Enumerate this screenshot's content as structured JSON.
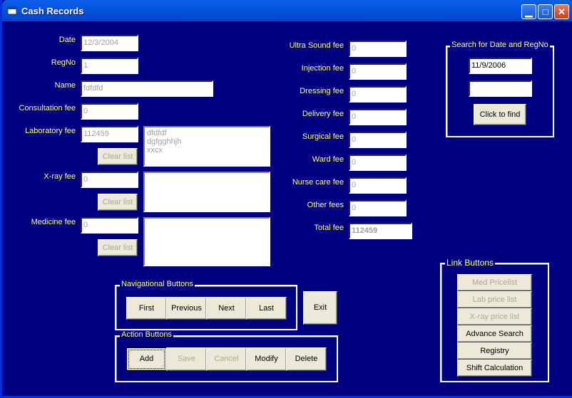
{
  "window": {
    "title": "Cash Records"
  },
  "left_fields": {
    "date": {
      "label": "Date",
      "value": "12/3/2004"
    },
    "regno": {
      "label": "RegNo",
      "value": "1"
    },
    "name": {
      "label": "Name",
      "value": "fdfdfd"
    },
    "consultation": {
      "label": "Consultation fee",
      "value": "0"
    },
    "laboratory": {
      "label": "Laboratory fee",
      "value": "112459",
      "list": [
        "dfdfdf",
        "dgfgghhjh",
        "xxcx"
      ],
      "clear_label": "Clear list"
    },
    "xray": {
      "label": "X-ray fee",
      "value": "0",
      "clear_label": "Clear list"
    },
    "medicine": {
      "label": "Medicine fee",
      "value": "0",
      "clear_label": "Clear list"
    }
  },
  "mid_fields": [
    {
      "label": "Ultra Sound fee",
      "value": "0"
    },
    {
      "label": "Injection fee",
      "value": "0"
    },
    {
      "label": "Dressing fee",
      "value": "0"
    },
    {
      "label": "Delivery fee",
      "value": "0"
    },
    {
      "label": "Surgical fee",
      "value": "0"
    },
    {
      "label": "Ward fee",
      "value": "0"
    },
    {
      "label": "Nurse care fee",
      "value": "0"
    },
    {
      "label": "Other fees",
      "value": "0"
    }
  ],
  "total": {
    "label": "Total fee",
    "value": "112459"
  },
  "search": {
    "title": "Search for Date and RegNo",
    "date_value": "11/9/2006",
    "regno_value": "",
    "button": "Click to find"
  },
  "nav": {
    "title": "Navigational Buttons",
    "first": "First",
    "previous": "Previous",
    "next": "Next",
    "last": "Last"
  },
  "exit_label": "Exit",
  "actions": {
    "title": "Action Buttons",
    "add": "Add",
    "save": "Save",
    "cancel": "Cancel",
    "modify": "Modify",
    "delete": "Delete"
  },
  "links": {
    "title": "Link Buttons",
    "items": [
      "Med Pricelist",
      "Lab price list",
      "X-ray price list",
      "Advance Search",
      "Registry",
      "Shift Calculation"
    ]
  }
}
